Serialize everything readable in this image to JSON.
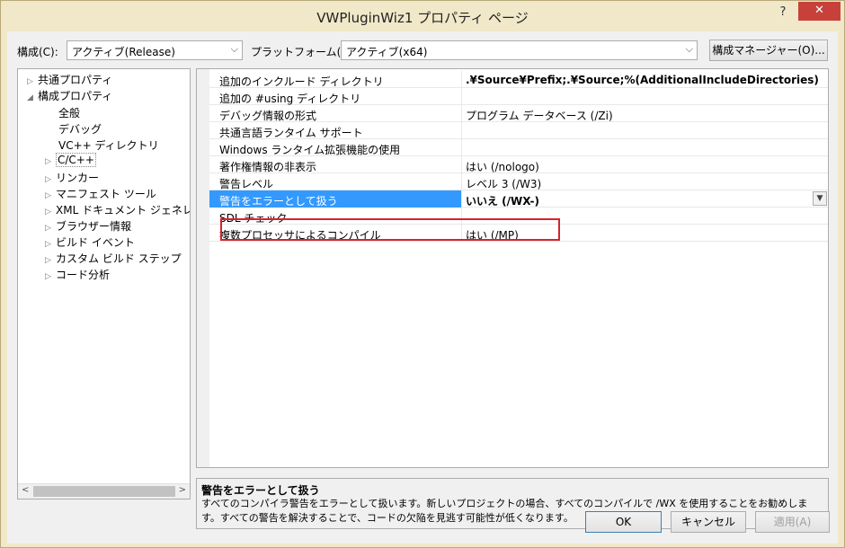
{
  "window": {
    "title": "VWPluginWiz1 プロパティ ページ",
    "help": "?",
    "close": "✕"
  },
  "toolbar": {
    "config_label": "構成(C):",
    "config_value": "アクティブ(Release)",
    "platform_label": "プラットフォーム(P):",
    "platform_value": "アクティブ(x64)",
    "config_manager_button": "構成マネージャー(O)..."
  },
  "tree": {
    "items": [
      {
        "label": "共通プロパティ",
        "expander": "▷"
      },
      {
        "label": "構成プロパティ",
        "expander": "◢"
      },
      {
        "label": "全般",
        "expander": ""
      },
      {
        "label": "デバッグ",
        "expander": ""
      },
      {
        "label": "VC++ ディレクトリ",
        "expander": ""
      },
      {
        "label": "C/C++",
        "expander": "▷"
      },
      {
        "label": "リンカー",
        "expander": "▷"
      },
      {
        "label": "マニフェスト ツール",
        "expander": "▷"
      },
      {
        "label": "XML ドキュメント ジェネレータ",
        "expander": "▷"
      },
      {
        "label": "ブラウザー情報",
        "expander": "▷"
      },
      {
        "label": "ビルド イベント",
        "expander": "▷"
      },
      {
        "label": "カスタム ビルド ステップ",
        "expander": "▷"
      },
      {
        "label": "コード分析",
        "expander": "▷"
      }
    ]
  },
  "grid": {
    "rows": [
      {
        "name": "追加のインクルード ディレクトリ",
        "value": ".¥Source¥Prefix;.¥Source;%(AdditionalIncludeDirectories)"
      },
      {
        "name": "追加の #using ディレクトリ",
        "value": ""
      },
      {
        "name": "デバッグ情報の形式",
        "value": "プログラム データベース (/Zi)"
      },
      {
        "name": "共通言語ランタイム サポート",
        "value": ""
      },
      {
        "name": "Windows ランタイム拡張機能の使用",
        "value": ""
      },
      {
        "name": "著作権情報の非表示",
        "value": "はい (/nologo)"
      },
      {
        "name": "警告レベル",
        "value": "レベル 3 (/W3)"
      },
      {
        "name": "警告をエラーとして扱う",
        "value": "いいえ (/WX-)"
      },
      {
        "name": "SDL チェック",
        "value": ""
      },
      {
        "name": "複数プロセッサによるコンパイル",
        "value": "はい (/MP)"
      }
    ]
  },
  "description": {
    "title": "警告をエラーとして扱う",
    "body": "すべてのコンパイラ警告をエラーとして扱います。新しいプロジェクトの場合、すべてのコンパイルで /WX を使用することをお勧めします。すべての警告を解決することで、コードの欠陥を見逃す可能性が低くなります。"
  },
  "buttons": {
    "ok": "OK",
    "cancel": "キャンセル",
    "apply": "適用(A)"
  },
  "colors": {
    "title_bg": "#f0e8c8",
    "selection": "#3399ff",
    "highlight_border": "#d9222b",
    "close_button": "#c7413a"
  }
}
